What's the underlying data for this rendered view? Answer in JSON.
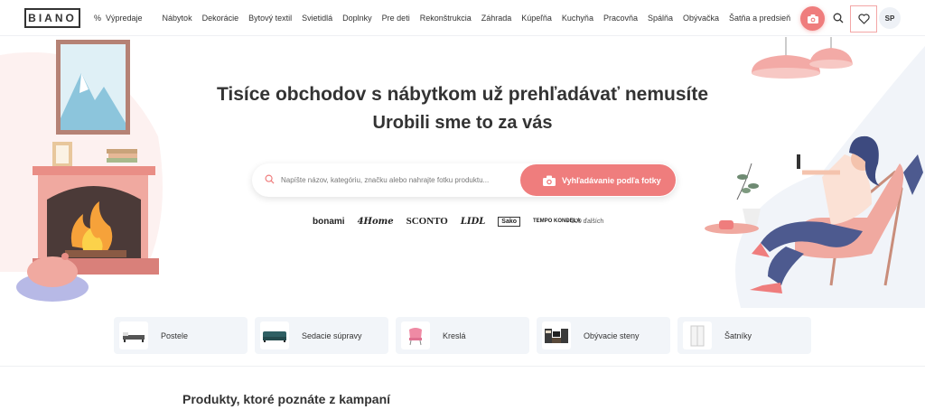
{
  "header": {
    "logo": "BIANO",
    "sale_label": "Výpredaje",
    "sale_prefix": "%",
    "nav": [
      "Nábytok",
      "Dekorácie",
      "Bytový textil",
      "Svietidlá",
      "Doplnky",
      "Pre deti",
      "Rekonštrukcia",
      "Záhrada",
      "Kúpeľňa",
      "Kuchyňa",
      "Pracovňa",
      "Spálňa",
      "Obývačka",
      "Šatňa a predsieň"
    ],
    "avatar_initials": "SP",
    "icons": {
      "camera": "camera-icon",
      "search": "search-icon",
      "favorites": "heart-icon"
    }
  },
  "hero": {
    "title": "Tisíce obchodov s nábytkom už prehľadávať nemusíte",
    "subtitle": "Urobili sme to za vás",
    "search_placeholder": "Napíšte názov, kategóriu, značku alebo nahrajte fotku produktu...",
    "photo_search_label": "Vyhľadávanie podľa fotky",
    "brands": [
      "bonami",
      "4Home",
      "SCONTO",
      "LIDL",
      "Sako",
      "TEMPO KONDELA"
    ],
    "brands_more": "+ 300 ďalších"
  },
  "categories": [
    {
      "label": "Postele"
    },
    {
      "label": "Sedacie súpravy"
    },
    {
      "label": "Kreslá"
    },
    {
      "label": "Obývacie steny"
    },
    {
      "label": "Šatníky"
    }
  ],
  "section": {
    "title": "Produkty, ktoré poznáte z kampaní"
  },
  "colors": {
    "accent": "#ef7d7d",
    "text": "#333333",
    "card_bg": "#f2f5f9",
    "illustration_pink": "#f0a9a0",
    "illustration_blue": "#4d5a8f"
  }
}
